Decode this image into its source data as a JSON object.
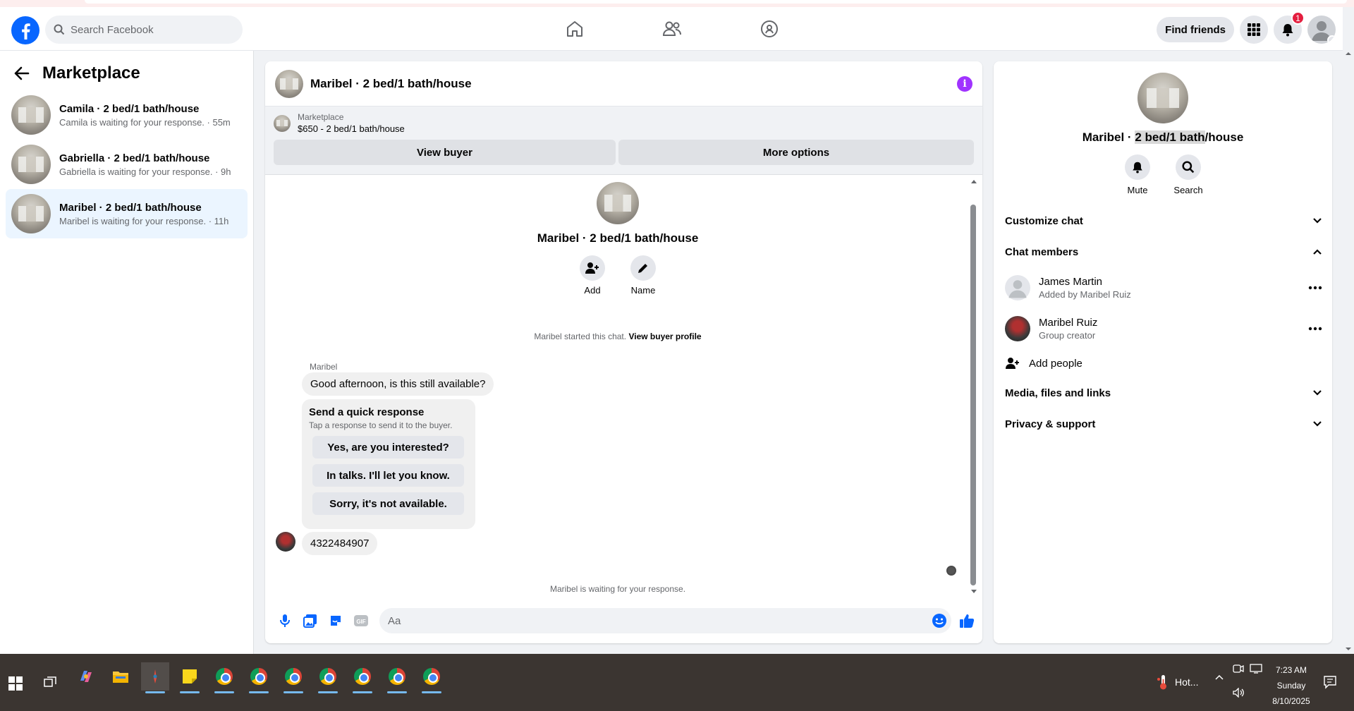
{
  "topnav": {
    "search_placeholder": "Search Facebook",
    "find_friends_label": "Find friends",
    "notification_count": "1"
  },
  "sidebar": {
    "title": "Marketplace",
    "conversations": [
      {
        "name": "Camila · 2 bed/1 bath/house",
        "preview": "Camila is waiting for your response. · 55m"
      },
      {
        "name": "Gabriella · 2 bed/1 bath/house",
        "preview": "Gabriella is waiting for your response. · 9h"
      },
      {
        "name": "Maribel · 2 bed/1 bath/house",
        "preview": "Maribel is waiting for your response. · 11h"
      }
    ]
  },
  "chat": {
    "title": "Maribel · 2 bed/1 bath/house",
    "listing": {
      "label": "Marketplace",
      "price_title": "$650 - 2 bed/1 bath/house",
      "view_buyer_label": "View buyer",
      "more_options_label": "More options"
    },
    "intro": {
      "title": "Maribel · 2 bed/1 bath/house",
      "add_label": "Add",
      "name_label": "Name"
    },
    "started_note": "Maribel started this chat.",
    "view_profile_link": "View buyer profile",
    "sender_name": "Maribel",
    "first_message": "Good afternoon, is this still available?",
    "quick_response": {
      "title": "Send a quick response",
      "subtitle": "Tap a response to send it to the buyer.",
      "options": [
        "Yes, are you interested?",
        "In talks. I'll let you know.",
        "Sorry, it's not available."
      ]
    },
    "second_message": "4322484907",
    "waiting_note": "Maribel is waiting for your response.",
    "composer_placeholder": "Aa"
  },
  "details": {
    "title_prefix": "Maribel · ",
    "title_highlight": "2 bed/1 bath",
    "title_suffix": "/house",
    "mute_label": "Mute",
    "search_label": "Search",
    "sections": {
      "customize": "Customize chat",
      "members": "Chat members",
      "media": "Media, files and links",
      "privacy": "Privacy & support"
    },
    "members": [
      {
        "name": "James Martin",
        "role": "Added by Maribel Ruiz"
      },
      {
        "name": "Maribel Ruiz",
        "role": "Group creator"
      }
    ],
    "add_people_label": "Add people"
  },
  "taskbar": {
    "weather_text": "Hot...",
    "time": "7:23 AM",
    "day": "Sunday",
    "date": "8/10/2025"
  },
  "colors": {
    "facebook_blue": "#0866ff",
    "info_purple": "#a033ff",
    "active_conv_bg": "#ebf5ff",
    "notif_red": "#e41e3f"
  }
}
